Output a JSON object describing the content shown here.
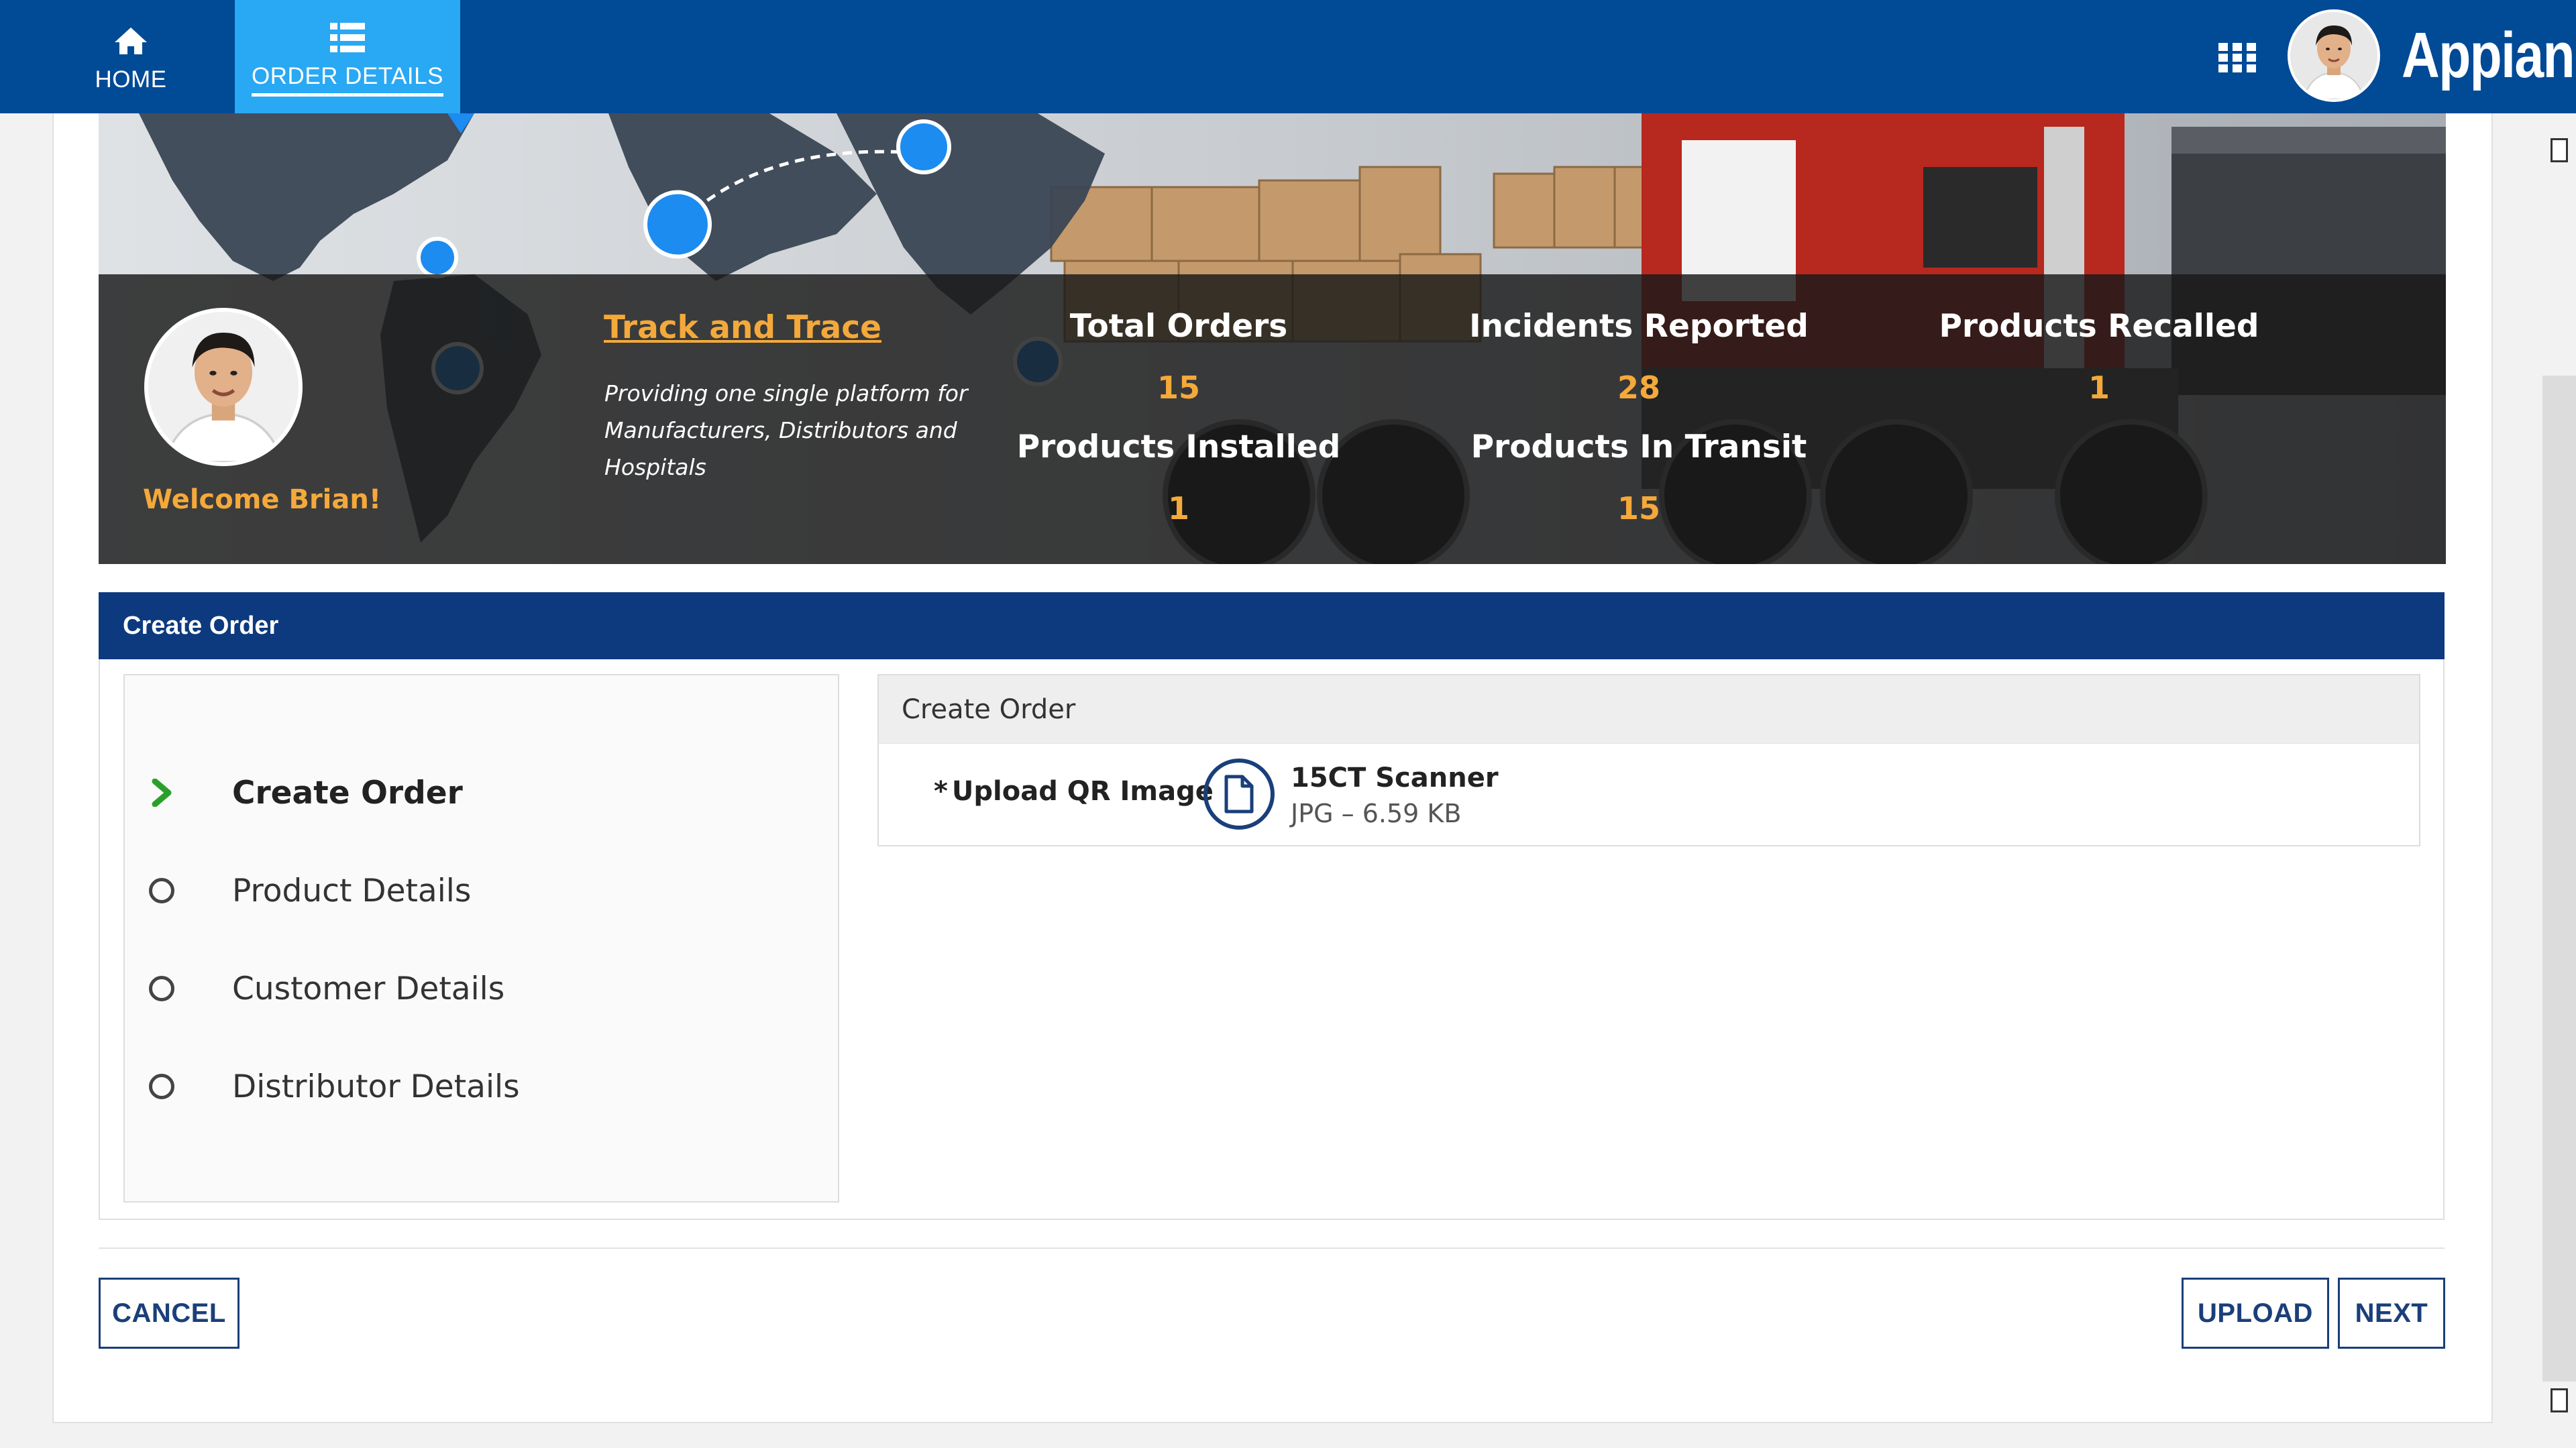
{
  "nav": {
    "home_label": "HOME",
    "order_details_label": "ORDER DETAILS",
    "brand": "Appian",
    "icons": {
      "home": "home-icon",
      "order": "list-icon",
      "apps": "grid-icon"
    }
  },
  "banner": {
    "welcome": "Welcome Brian!",
    "track_link": "Track and Trace",
    "tagline": "Providing one single platform for Manufacturers, Distributors and Hospitals",
    "stats": {
      "total_orders": {
        "label": "Total Orders",
        "value": "15"
      },
      "incidents_reported": {
        "label": "Incidents Reported",
        "value": "28"
      },
      "products_recalled": {
        "label": "Products Recalled",
        "value": "1"
      },
      "products_installed": {
        "label": "Products Installed",
        "value": "1"
      },
      "products_in_transit": {
        "label": "Products In Transit",
        "value": "15"
      }
    }
  },
  "section": {
    "title": "Create Order",
    "steps": [
      {
        "label": "Create Order",
        "state": "active"
      },
      {
        "label": "Product Details",
        "state": "pending"
      },
      {
        "label": "Customer Details",
        "state": "pending"
      },
      {
        "label": "Distributor Details",
        "state": "pending"
      }
    ],
    "form": {
      "title": "Create Order",
      "required_marker": "*",
      "upload_label": "Upload QR Image",
      "file_name": "15CT Scanner",
      "file_meta": "JPG – 6.59 KB"
    }
  },
  "actions": {
    "cancel": "CANCEL",
    "upload": "UPLOAD",
    "next": "NEXT"
  },
  "colors": {
    "nav_bg": "#004a96",
    "nav_active": "#29a8f4",
    "section_header": "#0d3a7e",
    "accent_orange": "#f4a93a",
    "step_check": "#2aa02a",
    "button_border": "#1a3f7a"
  }
}
